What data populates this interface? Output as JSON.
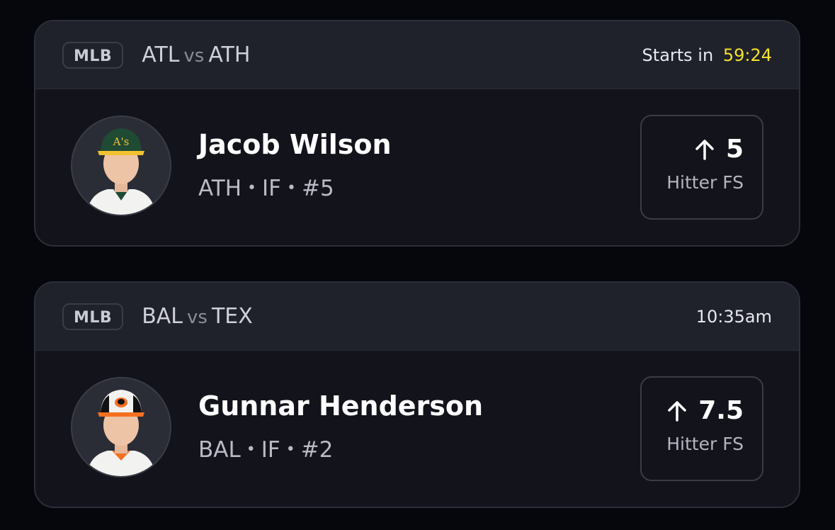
{
  "cards": [
    {
      "league": "MLB",
      "home": "ATL",
      "vs": "vs",
      "away": "ATH",
      "time_prefix": "Starts in",
      "countdown": "59:24",
      "player": {
        "name": "Jacob Wilson",
        "team": "ATH",
        "position": "IF",
        "number": "#5"
      },
      "projection": {
        "direction": "up",
        "value": "5",
        "stat": "Hitter FS"
      },
      "colors": {
        "cap": "#1f4a34",
        "logo": "#f2c230",
        "jersey": "#f2f2f0"
      }
    },
    {
      "league": "MLB",
      "home": "BAL",
      "vs": "vs",
      "away": "TEX",
      "time": "10:35am",
      "player": {
        "name": "Gunnar Henderson",
        "team": "BAL",
        "position": "IF",
        "number": "#2"
      },
      "projection": {
        "direction": "up",
        "value": "7.5",
        "stat": "Hitter FS"
      },
      "colors": {
        "cap": "#111111",
        "logo": "#f37021",
        "jersey": "#f2f2f0"
      }
    }
  ],
  "separator": "•"
}
